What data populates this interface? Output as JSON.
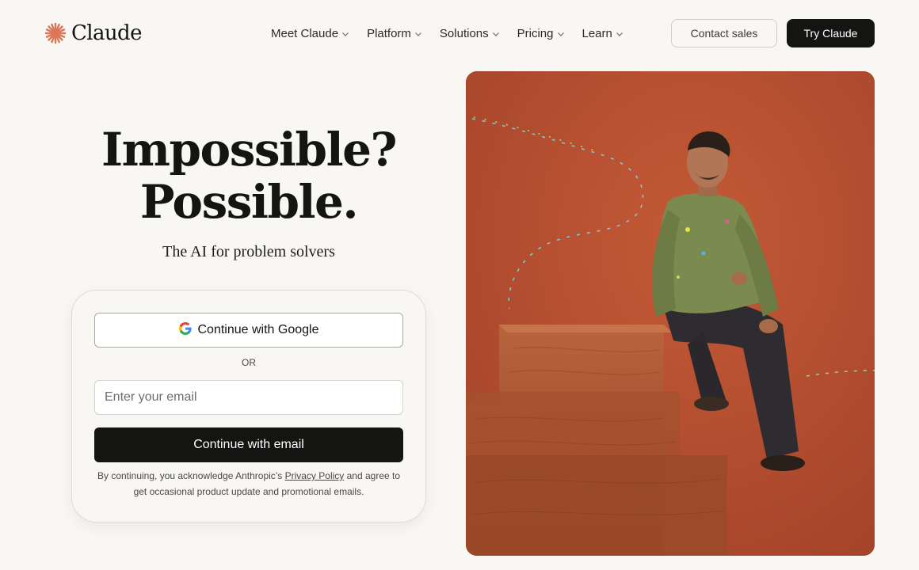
{
  "brand": {
    "name": "Claude",
    "logo_icon": "claude-spark-icon",
    "accent": "#d97757"
  },
  "nav": {
    "items": [
      {
        "label": "Meet Claude"
      },
      {
        "label": "Platform"
      },
      {
        "label": "Solutions"
      },
      {
        "label": "Pricing"
      },
      {
        "label": "Learn"
      }
    ],
    "contact_label": "Contact sales",
    "try_label": "Try Claude"
  },
  "hero": {
    "title_line1": "Impossible?",
    "title_line2": "Possible.",
    "subtitle": "The AI for problem solvers"
  },
  "auth": {
    "google_label": "Continue with Google",
    "google_icon": "google-icon",
    "or_label": "OR",
    "email_placeholder": "Enter your email",
    "email_value": "",
    "email_button_label": "Continue with email",
    "legal_prefix": "By continuing, you acknowledge Anthropic’s",
    "legal_link": "Privacy Policy",
    "legal_suffix": "and agree to get occasional product update and promotional emails."
  },
  "colors": {
    "background": "#f8f7f3",
    "primary_button": "#141413",
    "hero_image_bg": "#b64f2f"
  }
}
